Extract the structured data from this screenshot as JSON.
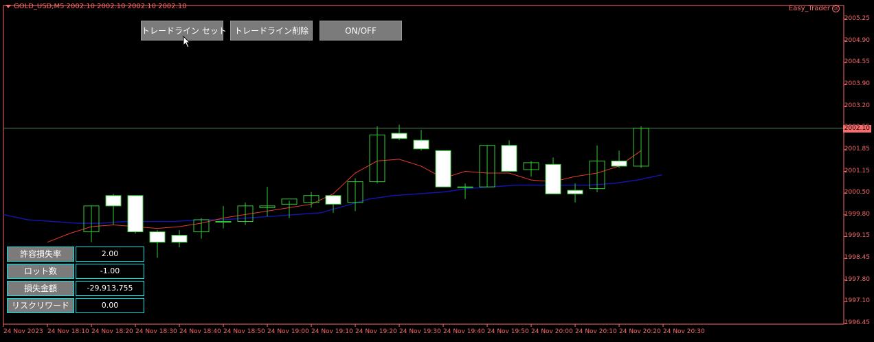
{
  "chart_header": {
    "symbol_info": "GOLD_USD,M5  2002.10 2002.10 2002.10 2002.10"
  },
  "expert": {
    "name": "Easy_Trader",
    "icon": "smiley-icon"
  },
  "buttons": {
    "set_trendline": "トレードライン セット",
    "delete_trendline": "トレードライン削除",
    "toggle": "ON/OFF"
  },
  "risk_panel": {
    "rows": [
      {
        "label": "許容損失率",
        "value": "2.00"
      },
      {
        "label": "ロット数",
        "value": "-1.00"
      },
      {
        "label": "損失金額",
        "value": "-29,913,755"
      },
      {
        "label": "リスクリワード",
        "value": "0.00"
      }
    ]
  },
  "current_price": "2002.10",
  "colors": {
    "background": "#000000",
    "axis": "#fa6d6d",
    "candle_border": "#33cc33",
    "candle_fill": "#ffffff",
    "ma_fast": "#e53c2a",
    "ma_slow": "#1414a8",
    "button_bg": "#7b7b7b",
    "panel_border": "#00e5e5"
  },
  "chart_data": {
    "type": "candlestick",
    "price_ticks": [
      "2005.25",
      "2004.90",
      "2004.55",
      "2003.90",
      "2003.20",
      "2002.55",
      "2001.85",
      "2001.15",
      "2000.50",
      "1999.80",
      "1999.15",
      "1998.45",
      "1997.80",
      "1997.10",
      "1996.45"
    ],
    "time_labels": [
      "24 Nov 2023",
      "24 Nov 18:10",
      "24 Nov 18:20",
      "24 Nov 18:30",
      "24 Nov 18:40",
      "24 Nov 18:50",
      "24 Nov 19:00",
      "24 Nov 19:10",
      "24 Nov 19:20",
      "24 Nov 19:30",
      "24 Nov 19:40",
      "24 Nov 19:50",
      "24 Nov 20:00",
      "24 Nov 20:10",
      "24 Nov 20:20",
      "24 Nov 20:30"
    ],
    "ylim": [
      1996.45,
      2005.25
    ],
    "candles": [
      {
        "o": 1999.1,
        "h": 1999.85,
        "l": 1998.8,
        "c": 1999.85
      },
      {
        "o": 2000.15,
        "h": 2000.2,
        "l": 1999.3,
        "c": 1999.85
      },
      {
        "o": 2000.15,
        "h": 2000.15,
        "l": 1999.05,
        "c": 1999.1
      },
      {
        "o": 1999.1,
        "h": 1999.15,
        "l": 1998.35,
        "c": 1998.8
      },
      {
        "o": 1999.0,
        "h": 1999.15,
        "l": 1998.65,
        "c": 1998.8
      },
      {
        "o": 1999.1,
        "h": 1999.5,
        "l": 1998.9,
        "c": 1999.45
      },
      {
        "o": 1999.4,
        "h": 1999.85,
        "l": 1999.2,
        "c": 1999.4
      },
      {
        "o": 1999.4,
        "h": 1999.95,
        "l": 1999.3,
        "c": 1999.85
      },
      {
        "o": 1999.8,
        "h": 2000.4,
        "l": 1999.55,
        "c": 1999.85
      },
      {
        "o": 1999.9,
        "h": 2000.0,
        "l": 1999.5,
        "c": 2000.05
      },
      {
        "o": 1999.95,
        "h": 2000.25,
        "l": 1999.8,
        "c": 2000.15
      },
      {
        "o": 2000.15,
        "h": 2000.15,
        "l": 1999.65,
        "c": 1999.9
      },
      {
        "o": 1999.95,
        "h": 2000.65,
        "l": 1999.7,
        "c": 2000.55
      },
      {
        "o": 2000.55,
        "h": 2002.15,
        "l": 2000.5,
        "c": 2001.9
      },
      {
        "o": 2001.95,
        "h": 2002.2,
        "l": 2001.75,
        "c": 2001.8
      },
      {
        "o": 2001.75,
        "h": 2002.05,
        "l": 2001.45,
        "c": 2001.5
      },
      {
        "o": 2001.45,
        "h": 2001.45,
        "l": 2000.4,
        "c": 2000.4
      },
      {
        "o": 2000.4,
        "h": 2000.5,
        "l": 2000.05,
        "c": 2000.4
      },
      {
        "o": 2000.4,
        "h": 2001.6,
        "l": 2000.4,
        "c": 2001.6
      },
      {
        "o": 2001.6,
        "h": 2001.75,
        "l": 2000.85,
        "c": 2000.85
      },
      {
        "o": 2000.9,
        "h": 2001.15,
        "l": 2000.7,
        "c": 2001.1
      },
      {
        "o": 2001.05,
        "h": 2001.25,
        "l": 2000.2,
        "c": 2000.2
      },
      {
        "o": 2000.3,
        "h": 2000.5,
        "l": 1999.95,
        "c": 2000.2
      },
      {
        "o": 2000.35,
        "h": 2001.6,
        "l": 2000.25,
        "c": 2001.15
      },
      {
        "o": 2001.15,
        "h": 2001.45,
        "l": 2000.95,
        "c": 2001.0
      },
      {
        "o": 2001.0,
        "h": 2002.15,
        "l": 2000.95,
        "c": 2002.1
      }
    ],
    "ma_fast": [
      1998.8,
      1999.05,
      1999.25,
      1999.3,
      1999.25,
      1999.2,
      1999.25,
      1999.35,
      1999.5,
      1999.6,
      1999.7,
      1999.8,
      1999.9,
      2000.2,
      2000.8,
      2001.15,
      2001.2,
      2001.0,
      2000.65,
      2000.85,
      2000.8,
      2000.8,
      2000.6,
      2000.55,
      2000.7,
      2000.8,
      2001.0,
      2001.45
    ],
    "ma_slow": [
      1999.6,
      1999.45,
      1999.4,
      1999.35,
      1999.35,
      1999.4,
      1999.4,
      1999.4,
      1999.45,
      1999.45,
      1999.5,
      1999.55,
      1999.6,
      1999.65,
      1999.85,
      2000.05,
      2000.15,
      2000.2,
      2000.25,
      2000.35,
      2000.4,
      2000.45,
      2000.45,
      2000.45,
      2000.45,
      2000.5,
      2000.6,
      2000.75
    ]
  }
}
